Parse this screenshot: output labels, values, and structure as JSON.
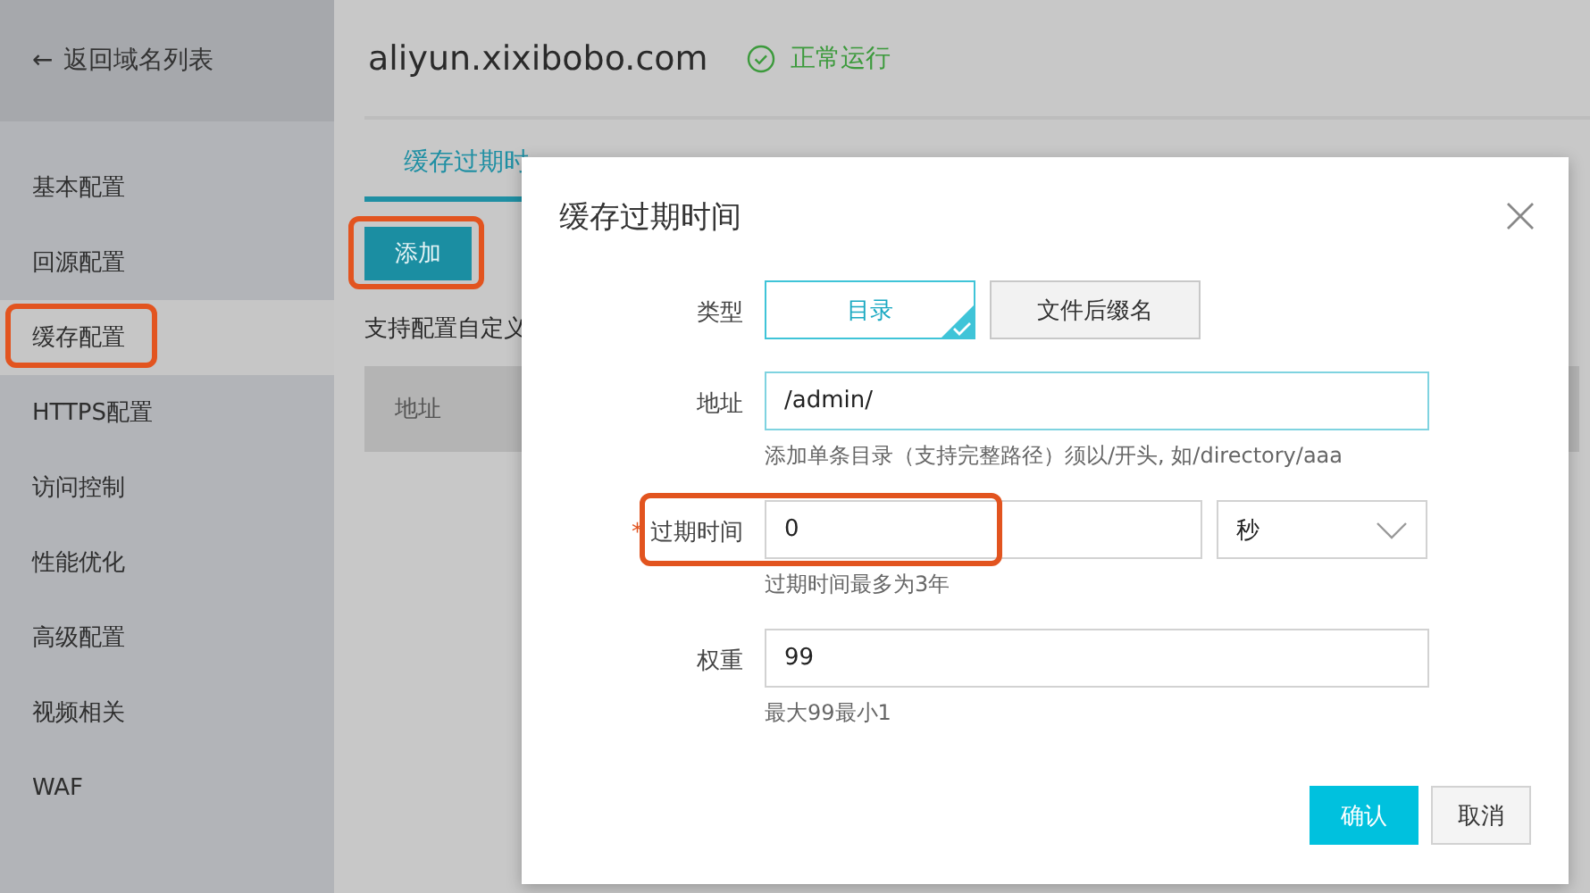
{
  "sidebar": {
    "back_link": {
      "arrow": "←",
      "label": "返回域名列表"
    },
    "items": [
      {
        "label": "基本配置",
        "selected": false,
        "highlighted": false
      },
      {
        "label": "回源配置",
        "selected": false,
        "highlighted": false
      },
      {
        "label": "缓存配置",
        "selected": true,
        "highlighted": true
      },
      {
        "label": "HTTPS配置",
        "selected": false,
        "highlighted": false
      },
      {
        "label": "访问控制",
        "selected": false,
        "highlighted": false
      },
      {
        "label": "性能优化",
        "selected": false,
        "highlighted": false
      },
      {
        "label": "高级配置",
        "selected": false,
        "highlighted": false
      },
      {
        "label": "视频相关",
        "selected": false,
        "highlighted": false
      },
      {
        "label": "WAF",
        "selected": false,
        "highlighted": false
      }
    ]
  },
  "header": {
    "domain": "aliyun.xixibobo.com",
    "status": "正常运行"
  },
  "tabs": [
    {
      "label": "缓存过期时",
      "selected": true
    }
  ],
  "add_button": {
    "label": "添加",
    "highlighted": true
  },
  "description": "支持配置自定义",
  "table": {
    "columns": [
      "地址"
    ]
  },
  "dialog": {
    "title": "缓存过期时间",
    "type_field": {
      "label": "类型",
      "options": [
        {
          "label": "目录",
          "selected": true
        },
        {
          "label": "文件后缀名",
          "selected": false
        }
      ]
    },
    "address_field": {
      "label": "地址",
      "value": "/admin/",
      "hint": "添加单条目录（支持完整路径）须以/开头, 如/directory/aaa"
    },
    "expiry_field": {
      "required_mark": "*",
      "label": "过期时间",
      "value": "0",
      "unit": "秒",
      "hint": "过期时间最多为3年",
      "highlighted": true
    },
    "weight_field": {
      "label": "权重",
      "value": "99",
      "hint": "最大99最小1"
    },
    "buttons": [
      {
        "label": "确认",
        "kind": "primary"
      },
      {
        "label": "取消",
        "kind": "secondary"
      }
    ]
  }
}
